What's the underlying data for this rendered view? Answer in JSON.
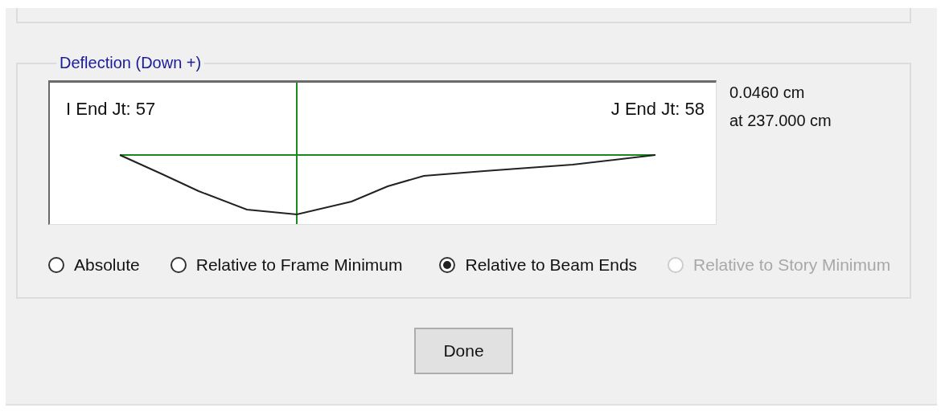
{
  "group": {
    "title": "Deflection (Down +)"
  },
  "diagram": {
    "i_end": "I End Jt: 57",
    "j_end": "J End Jt: 58"
  },
  "max_deflection": {
    "value": "0.0460 cm",
    "location": "at 237.000 cm"
  },
  "options": [
    {
      "label": "Absolute",
      "selected": false,
      "disabled": false
    },
    {
      "label": "Relative to Frame Minimum",
      "selected": false,
      "disabled": false
    },
    {
      "label": "Relative to Beam Ends",
      "selected": true,
      "disabled": false
    },
    {
      "label": "Relative to Story Minimum",
      "selected": false,
      "disabled": true
    }
  ],
  "buttons": [
    "Done"
  ]
}
